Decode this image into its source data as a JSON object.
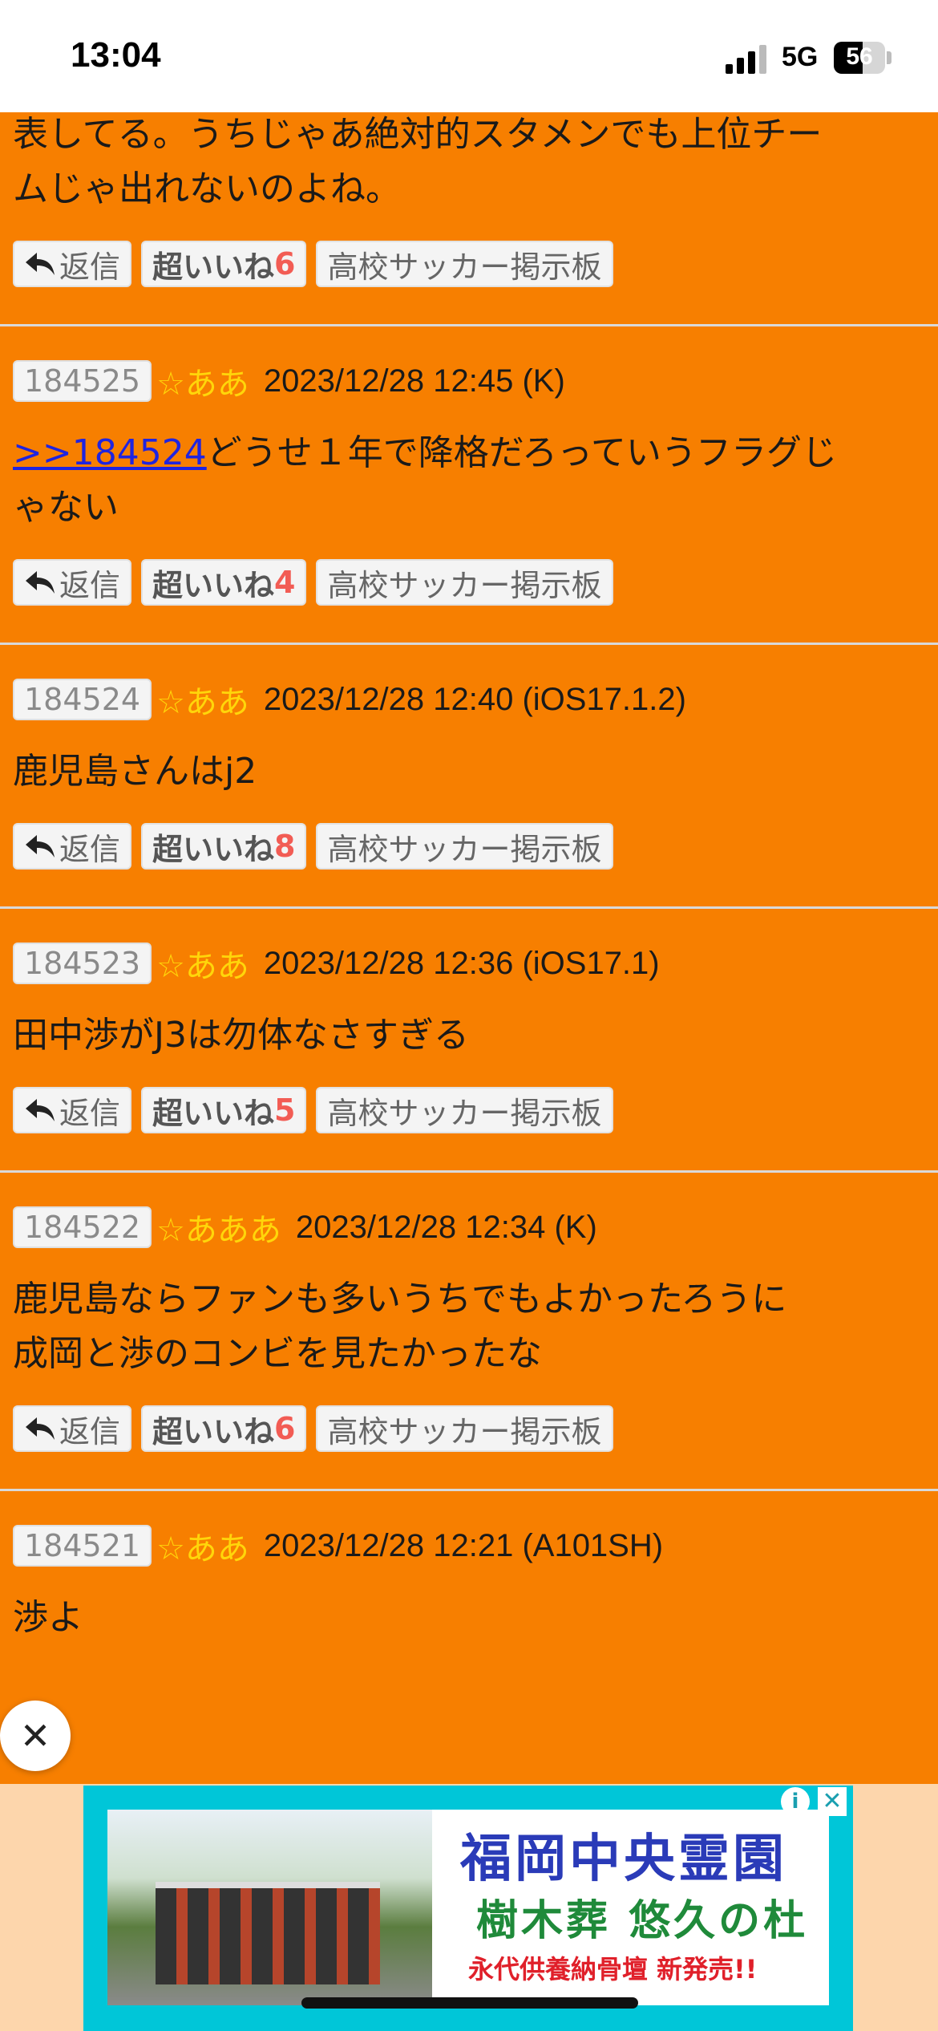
{
  "status_bar": {
    "time": "13:04",
    "network": "5G",
    "battery_level": "56",
    "battery_fraction": 0.56
  },
  "posts": [
    {
      "partial": true,
      "body_lines": [
        "表してる。うちじゃあ絶対的スタメンでも上位チー",
        "ムじゃ出れないのよね。"
      ],
      "reply_label": "返信",
      "like_label": "超いいね",
      "like_count": "6",
      "board_label": "高校サッカー掲示板"
    },
    {
      "number": "184525",
      "name": "☆ああ",
      "date": "2023/12/28 12:45 (K)",
      "reply_ref": ">>184524",
      "body_after_ref": "どうせ１年で降格だろっていうフラグじ",
      "body_line2": "ゃない",
      "reply_label": "返信",
      "like_label": "超いいね",
      "like_count": "4",
      "board_label": "高校サッカー掲示板"
    },
    {
      "number": "184524",
      "name": "☆ああ",
      "date": "2023/12/28 12:40 (iOS17.1.2)",
      "body": "鹿児島さんはj2",
      "reply_label": "返信",
      "like_label": "超いいね",
      "like_count": "8",
      "board_label": "高校サッカー掲示板"
    },
    {
      "number": "184523",
      "name": "☆ああ",
      "date": "2023/12/28 12:36 (iOS17.1)",
      "body": "田中渉がJ3は勿体なさすぎる",
      "reply_label": "返信",
      "like_label": "超いいね",
      "like_count": "5",
      "board_label": "高校サッカー掲示板"
    },
    {
      "number": "184522",
      "name": "☆あああ",
      "date": "2023/12/28 12:34 (K)",
      "body_lines": [
        "鹿児島ならファンも多いうちでもよかったろうに",
        "成岡と渉のコンビを見たかったな"
      ],
      "reply_label": "返信",
      "like_label": "超いいね",
      "like_count": "6",
      "board_label": "高校サッカー掲示板"
    },
    {
      "number": "184521",
      "name": "☆ああ",
      "date": "2023/12/28 12:21 (A101SH)",
      "body": "渉よ"
    }
  ],
  "ad": {
    "title": "福岡中央霊園",
    "subtitle": "樹木葬 悠久の杜",
    "tagline": "永代供養納骨壇 新発売!!",
    "info_glyph": "i",
    "close_glyph": "✕"
  },
  "close_button_glyph": "✕"
}
